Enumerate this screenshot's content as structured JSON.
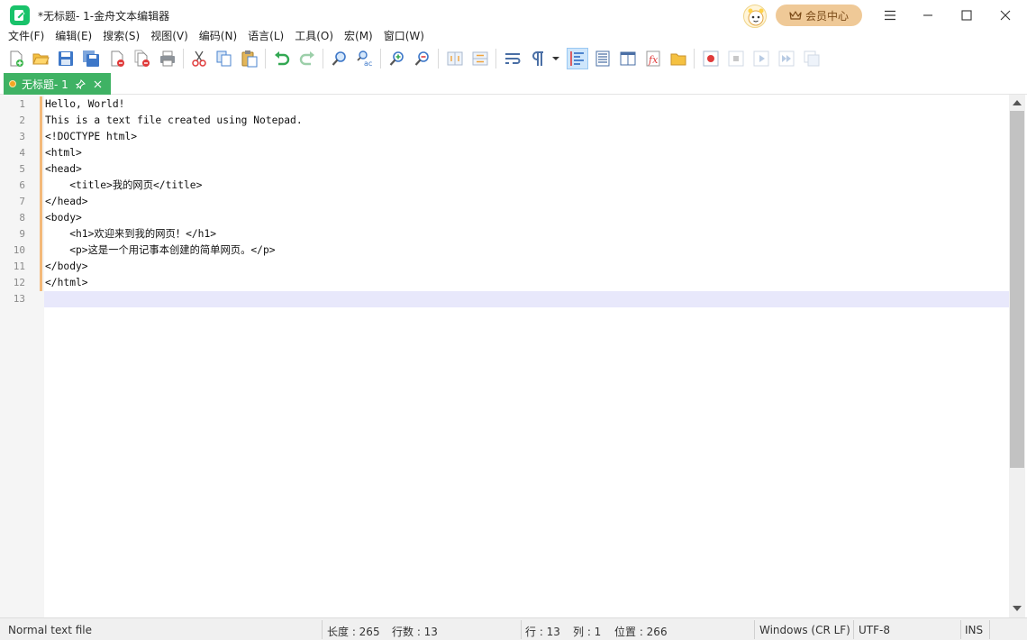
{
  "window": {
    "title": "*无标题- 1-金舟文本编辑器",
    "vip_label": "会员中心"
  },
  "menu": [
    "文件(F)",
    "编辑(E)",
    "搜索(S)",
    "视图(V)",
    "编码(N)",
    "语言(L)",
    "工具(O)",
    "宏(M)",
    "窗口(W)"
  ],
  "toolbar": {
    "icons": [
      "new-file-icon",
      "open-file-icon",
      "save-icon",
      "save-all-icon",
      "close-file-icon",
      "close-all-icon",
      "print-icon",
      "cut-icon",
      "copy-icon",
      "paste-icon",
      "undo-icon",
      "redo-icon",
      "find-icon",
      "replace-icon",
      "zoom-in-icon",
      "zoom-out-icon",
      "sync-vertical-icon",
      "sync-horizontal-icon",
      "word-wrap-icon",
      "show-all-chars-icon",
      "dropdown-arrow-icon",
      "indent-guide-icon",
      "document-map-icon",
      "function-list-icon",
      "function-icon",
      "folder-workspace-icon",
      "record-macro-icon",
      "stop-macro-icon",
      "play-macro-icon",
      "run-macro-multiple-icon",
      "save-macro-icon"
    ]
  },
  "tab": {
    "title": "无标题- 1"
  },
  "editor": {
    "line_numbers": [
      "1",
      "2",
      "3",
      "4",
      "5",
      "6",
      "7",
      "8",
      "9",
      "10",
      "11",
      "12",
      "13"
    ],
    "lines": [
      "Hello, World!",
      "This is a text file created using Notepad.",
      "<!DOCTYPE html>",
      "<html>",
      "<head>",
      "    <title>我的网页</title>",
      "</head>",
      "<body>",
      "    <h1>欢迎来到我的网页！</h1>",
      "    <p>这是一个用记事本创建的简单网页。</p>",
      "</body>",
      "</html>",
      ""
    ]
  },
  "status": {
    "file_type": "Normal text file",
    "length": "长度 : 265",
    "lines": "行数 : 13",
    "row": "行 : 13",
    "col": "列 : 1",
    "position": "位置 : 266",
    "eol": "Windows (CR LF)",
    "encoding": "UTF-8",
    "mode": "INS"
  },
  "colors": {
    "accent": "#3fb264",
    "current_line": "#e8e8fb",
    "change_bar": "#f3b97a"
  }
}
